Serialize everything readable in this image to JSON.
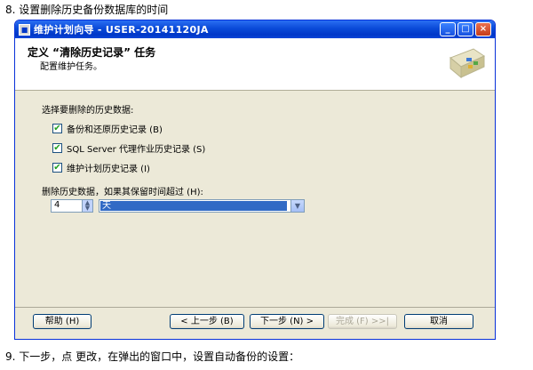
{
  "doc": {
    "top_text": "8. 设置删除历史备份数据库的时间",
    "bottom_text": "9. 下一步，点 更改，在弹出的窗口中，设置自动备份的设置："
  },
  "window": {
    "title": "维护计划向导 - USER-20141120JA",
    "minimize": "_",
    "maximize": "□",
    "close": "×"
  },
  "header": {
    "title": "定义 “清除历史记录” 任务",
    "subtitle": "配置维护任务。"
  },
  "main": {
    "select_label": "选择要删除的历史数据:",
    "checkboxes": [
      {
        "label": "备份和还原历史记录 (B)",
        "checked": true
      },
      {
        "label": "SQL Server 代理作业历史记录 (S)",
        "checked": true
      },
      {
        "label": "维护计划历史记录 (I)",
        "checked": true
      }
    ],
    "delete_label": "删除历史数据，如果其保留时间超过 (H):",
    "retention_value": "4",
    "retention_unit": "天"
  },
  "footer": {
    "help": "帮助 (H)",
    "back": "< 上一步 (B)",
    "next": "下一步 (N) >",
    "finish": "完成 (F) >>|",
    "cancel": "取消"
  },
  "icons": {
    "check": "✔",
    "spin": "▲▼",
    "dropdown": "▼"
  }
}
